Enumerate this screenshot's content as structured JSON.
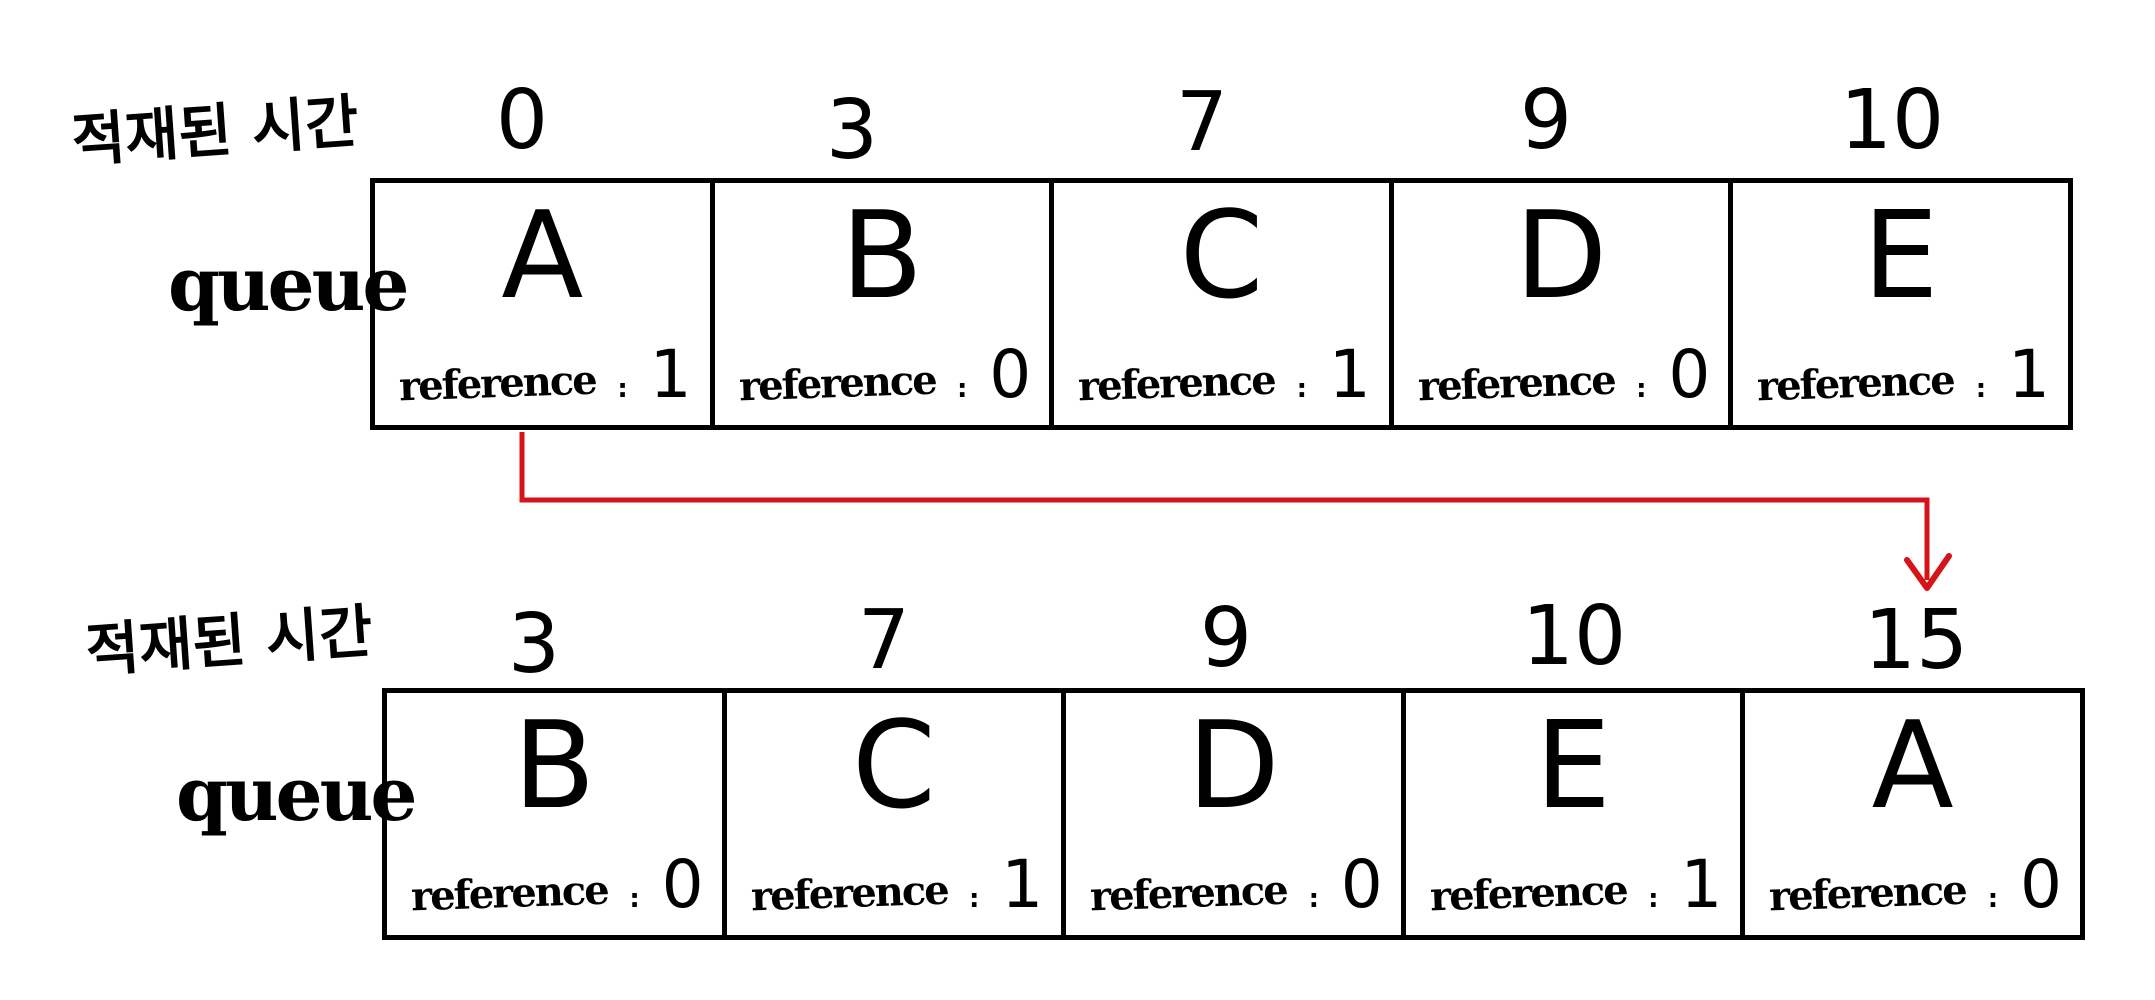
{
  "colors": {
    "ink": "#000000",
    "arrow": "#d41418"
  },
  "before": {
    "time_label": "적재된 시간",
    "queue_label": "queue",
    "ticks": [
      "0",
      "3",
      "7",
      "9",
      "10"
    ],
    "cells": [
      {
        "letter": "A",
        "ref_word": "reference",
        "ref_sep": ":",
        "ref_value": "1"
      },
      {
        "letter": "B",
        "ref_word": "reference",
        "ref_sep": ":",
        "ref_value": "0"
      },
      {
        "letter": "C",
        "ref_word": "reference",
        "ref_sep": ":",
        "ref_value": "1"
      },
      {
        "letter": "D",
        "ref_word": "reference",
        "ref_sep": ":",
        "ref_value": "0"
      },
      {
        "letter": "E",
        "ref_word": "reference",
        "ref_sep": ":",
        "ref_value": "1"
      }
    ]
  },
  "after": {
    "time_label": "적재된 시간",
    "queue_label": "queue",
    "ticks": [
      "3",
      "7",
      "9",
      "10",
      "15"
    ],
    "cells": [
      {
        "letter": "B",
        "ref_word": "reference",
        "ref_sep": ":",
        "ref_value": "0"
      },
      {
        "letter": "C",
        "ref_word": "reference",
        "ref_sep": ":",
        "ref_value": "1"
      },
      {
        "letter": "D",
        "ref_word": "reference",
        "ref_sep": ":",
        "ref_value": "0"
      },
      {
        "letter": "E",
        "ref_word": "reference",
        "ref_sep": ":",
        "ref_value": "1"
      },
      {
        "letter": "A",
        "ref_word": "reference",
        "ref_sep": ":",
        "ref_value": "0"
      }
    ]
  },
  "arrow_icon": "arrow-down-icon"
}
